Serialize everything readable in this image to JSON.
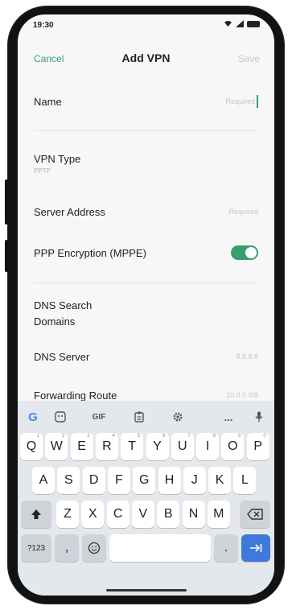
{
  "status": {
    "time": "19:30"
  },
  "nav": {
    "cancel": "Cancel",
    "title": "Add VPN",
    "save": "Save"
  },
  "form": {
    "name": {
      "label": "Name",
      "placeholder": "Required"
    },
    "vpn_type": {
      "label": "VPN Type",
      "value": "PPTP"
    },
    "server": {
      "label": "Server Address",
      "placeholder": "Required"
    },
    "encryption": {
      "label": "PPP Encryption (MPPE)",
      "on": true
    },
    "dns_search": {
      "label_line1": "DNS Search",
      "label_line2": "Domains"
    },
    "dns_server": {
      "label": "DNS Server",
      "placeholder": "8.8.8.8"
    },
    "forwarding": {
      "label": "Forwarding Route",
      "placeholder": "10.0.0.0/8"
    }
  },
  "keyboard": {
    "toolbar": {
      "google": "G",
      "gif": "GIF",
      "more": "..."
    },
    "row1": [
      "Q",
      "W",
      "E",
      "R",
      "T",
      "Y",
      "U",
      "I",
      "O",
      "P"
    ],
    "row1_hints": [
      "1",
      "2",
      "3",
      "4",
      "5",
      "6",
      "7",
      "8",
      "9",
      "0"
    ],
    "row2": [
      "A",
      "S",
      "D",
      "F",
      "G",
      "H",
      "J",
      "K",
      "L"
    ],
    "row3": [
      "Z",
      "X",
      "C",
      "V",
      "B",
      "N",
      "M"
    ],
    "symbols_label": "?123",
    "comma": ",",
    "period": "."
  },
  "colors": {
    "accent": "#3a9d6e",
    "enter": "#3f79d9"
  }
}
